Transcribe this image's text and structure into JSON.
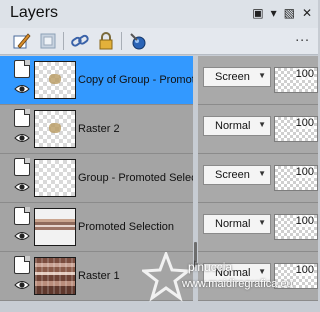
{
  "panel": {
    "title": "Layers",
    "controls": {
      "dock_icon": "restore-icon",
      "pin_icon": "pin-icon",
      "close_icon": "close-icon"
    }
  },
  "toolbar": {
    "tools": [
      "edit-layer-icon",
      "mask-icon",
      "link-icon",
      "lock-icon",
      "new-layer-icon"
    ],
    "overflow": "∙∙∙"
  },
  "layers": [
    {
      "name": "Copy of Group - Promoted",
      "blend": "Screen",
      "opacity": "100",
      "selected": true,
      "thumb": "checker-glyph"
    },
    {
      "name": "Raster 2",
      "blend": "Normal",
      "opacity": "100",
      "selected": false,
      "thumb": "checker-glyph"
    },
    {
      "name": "Group - Promoted Selection",
      "blend": "Screen",
      "opacity": "100",
      "selected": false,
      "thumb": "checker"
    },
    {
      "name": "Promoted Selection",
      "blend": "Normal",
      "opacity": "100",
      "selected": false,
      "thumb": "strip"
    },
    {
      "name": "Raster 1",
      "blend": "Normal",
      "opacity": "100",
      "selected": false,
      "thumb": "texture"
    }
  ],
  "watermark": {
    "line1": "pinuccia",
    "line2": "www.maidiregrafica.eu"
  },
  "colors": {
    "selected": "#3399ff",
    "row": "#a4a4a4",
    "panel": "#c7ccd3"
  }
}
